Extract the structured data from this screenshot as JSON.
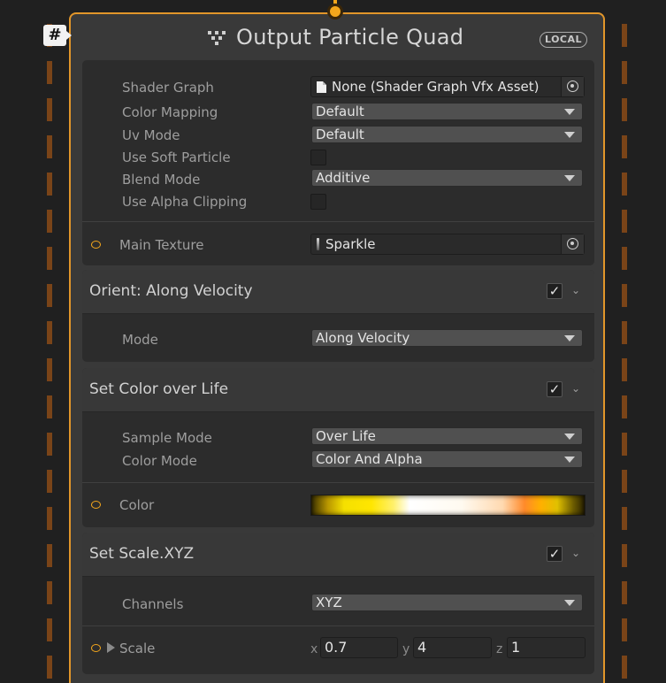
{
  "node": {
    "badge": "#",
    "title": "Output Particle Quad",
    "space": "LOCAL"
  },
  "output_settings": {
    "shader_graph": {
      "label": "Shader Graph",
      "value": "None (Shader Graph Vfx Asset)"
    },
    "color_mapping": {
      "label": "Color Mapping",
      "value": "Default"
    },
    "uv_mode": {
      "label": "Uv Mode",
      "value": "Default"
    },
    "use_soft_particle": {
      "label": "Use Soft Particle",
      "checked": false
    },
    "blend_mode": {
      "label": "Blend Mode",
      "value": "Additive"
    },
    "use_alpha_clipping": {
      "label": "Use Alpha Clipping",
      "checked": false
    },
    "main_texture": {
      "label": "Main Texture",
      "value": "Sparkle"
    }
  },
  "blocks": {
    "orient": {
      "title": "Orient: Along Velocity",
      "enabled": true,
      "mode": {
        "label": "Mode",
        "value": "Along Velocity"
      }
    },
    "color_over_life": {
      "title": "Set Color over Life",
      "enabled": true,
      "sample_mode": {
        "label": "Sample Mode",
        "value": "Over Life"
      },
      "color_mode": {
        "label": "Color Mode",
        "value": "Color And Alpha"
      },
      "color": {
        "label": "Color"
      }
    },
    "scale_xyz": {
      "title": "Set Scale.XYZ",
      "enabled": true,
      "channels": {
        "label": "Channels",
        "value": "XYZ"
      },
      "scale": {
        "label": "Scale",
        "x_label": "x",
        "x": "0.7",
        "y_label": "y",
        "y": "4",
        "z_label": "z",
        "z": "1"
      }
    }
  },
  "colors": {
    "node_border": "#e2962a",
    "port": "#f3a61c",
    "flow_dash": "#7a4418",
    "background": "#202020"
  },
  "icons": {
    "title": "vfx-output-icon",
    "object_picker": "object-picker-icon",
    "check": "✓",
    "chevron": "⌄"
  }
}
